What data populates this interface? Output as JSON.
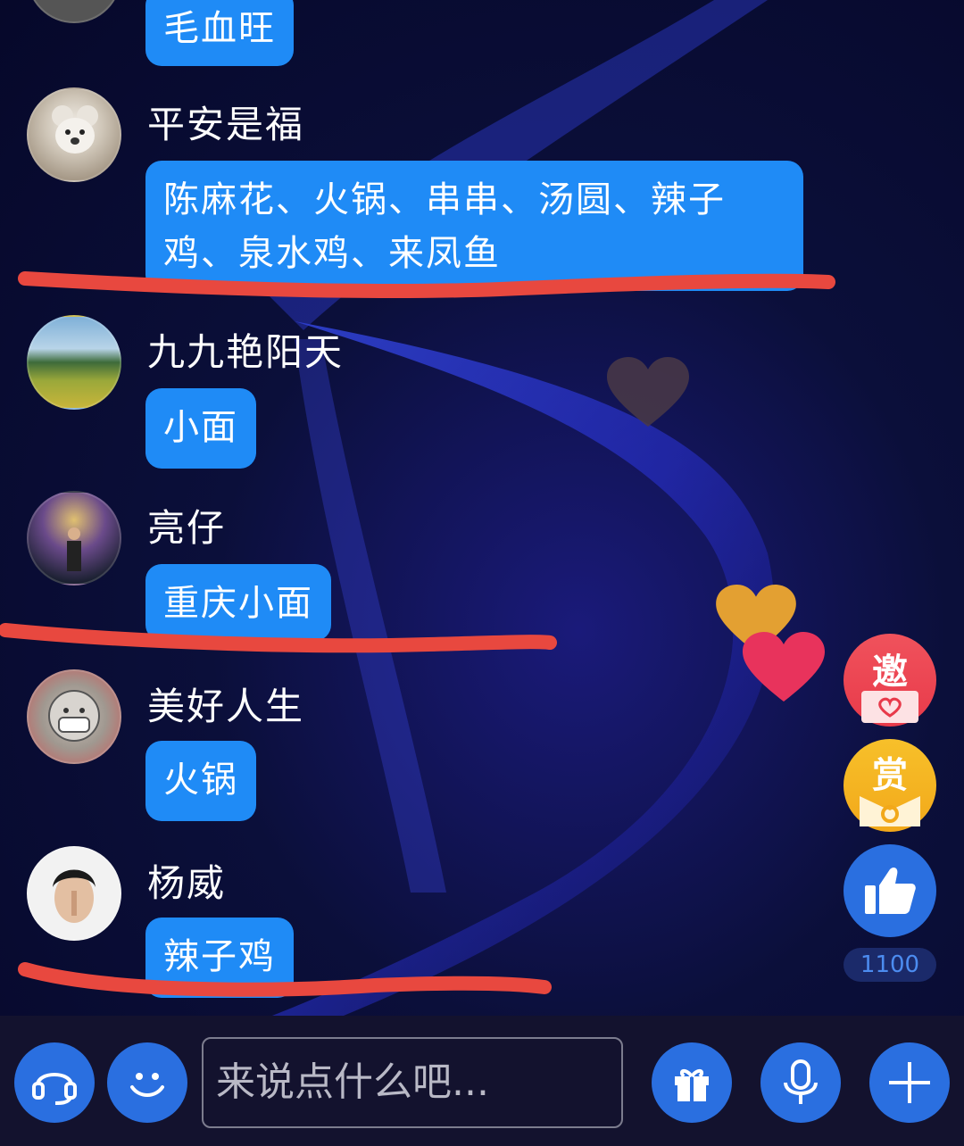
{
  "chat": {
    "messages": [
      {
        "name": "",
        "text": "毛血旺"
      },
      {
        "name": "平安是福",
        "text": "陈麻花、火锅、串串、汤圆、辣子鸡、泉水鸡、来凤鱼"
      },
      {
        "name": "九九艳阳天",
        "text": "小面"
      },
      {
        "name": "亮仔",
        "text": "重庆小面"
      },
      {
        "name": "美好人生",
        "text": "火锅"
      },
      {
        "name": "杨威",
        "text": "辣子鸡"
      }
    ]
  },
  "side": {
    "invite_label": "邀",
    "reward_label": "赏",
    "like_count": "1100"
  },
  "bottom": {
    "input_placeholder": "来说点什么吧...",
    "icons": [
      "headset-icon",
      "emoji-icon",
      "gift-icon",
      "microphone-icon",
      "plus-icon"
    ]
  },
  "colors": {
    "bubble": "#1f8bf6",
    "underline": "#e8483f",
    "background": "#0b0f3a",
    "button": "#2a6fe0"
  }
}
